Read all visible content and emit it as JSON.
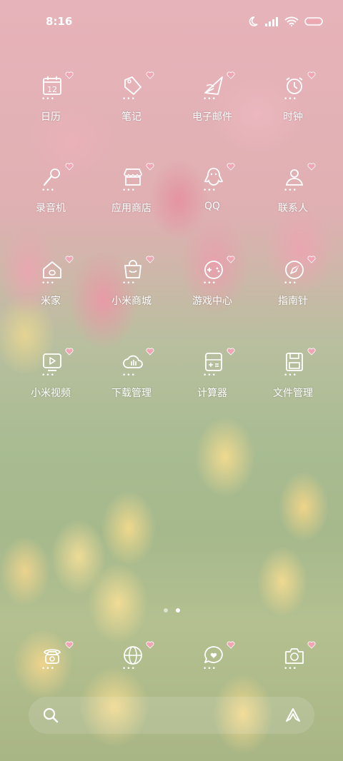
{
  "status_bar": {
    "time": "8:16",
    "icons": [
      "moon-icon",
      "signal-icon",
      "wifi-icon",
      "battery-icon"
    ]
  },
  "apps": [
    {
      "label": "日历",
      "icon": "calendar-icon",
      "calendar_day": "12"
    },
    {
      "label": "笔记",
      "icon": "notes-tag-icon"
    },
    {
      "label": "电子邮件",
      "icon": "email-icon"
    },
    {
      "label": "时钟",
      "icon": "alarm-clock-icon"
    },
    {
      "label": "录音机",
      "icon": "microphone-icon"
    },
    {
      "label": "应用商店",
      "icon": "store-icon"
    },
    {
      "label": "QQ",
      "icon": "penguin-icon"
    },
    {
      "label": "联系人",
      "icon": "contacts-icon"
    },
    {
      "label": "米家",
      "icon": "home-icon"
    },
    {
      "label": "小米商城",
      "icon": "shop-bag-icon"
    },
    {
      "label": "游戏中心",
      "icon": "gamepad-icon"
    },
    {
      "label": "指南针",
      "icon": "compass-icon"
    },
    {
      "label": "小米视频",
      "icon": "video-play-icon"
    },
    {
      "label": "下载管理",
      "icon": "cloud-download-icon"
    },
    {
      "label": "计算器",
      "icon": "calculator-icon"
    },
    {
      "label": "文件管理",
      "icon": "folder-icon"
    }
  ],
  "dots_text": "•••",
  "dock": [
    {
      "icon": "phone-icon"
    },
    {
      "icon": "browser-globe-icon"
    },
    {
      "icon": "message-icon"
    },
    {
      "icon": "camera-icon"
    }
  ],
  "page_indicator": {
    "total": 2,
    "current": 2
  },
  "search": {
    "icon": "search-icon",
    "assistant_icon": "assistant-icon"
  },
  "colors": {
    "heart": "#f0a5b3",
    "icon_stroke": "#ffffff"
  }
}
